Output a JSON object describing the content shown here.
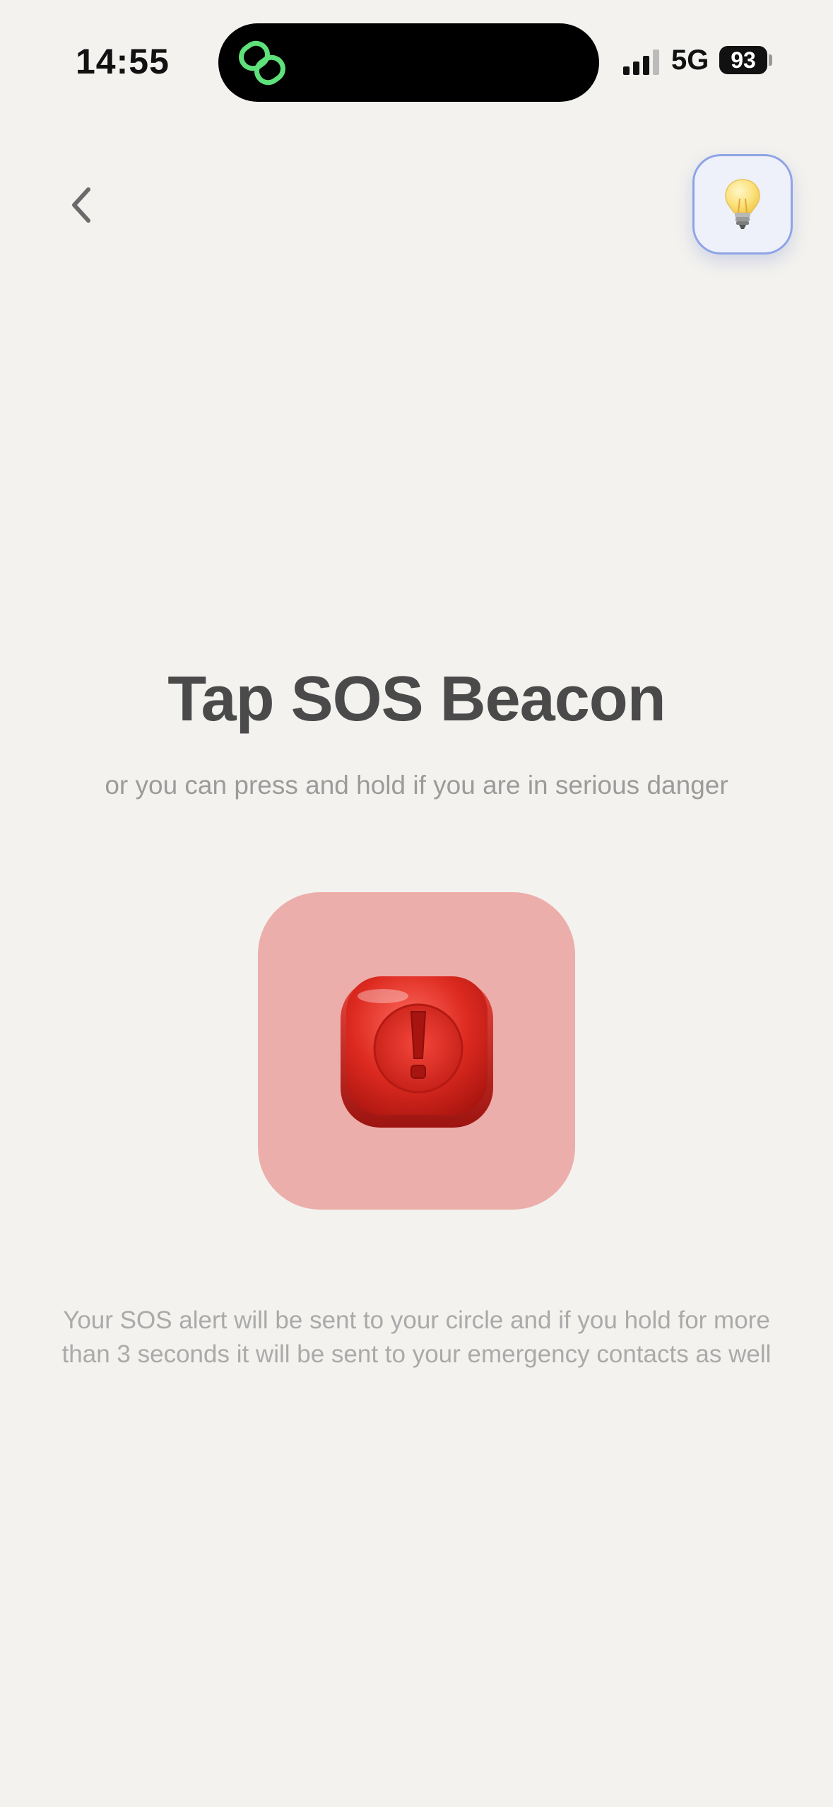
{
  "status_bar": {
    "time": "14:55",
    "network": "5G",
    "battery": "93",
    "island_icon": "link-rings-icon"
  },
  "header": {
    "back_icon": "chevron-left-icon",
    "tips_icon": "lightbulb-icon"
  },
  "main": {
    "title": "Tap SOS Beacon",
    "subtitle": "or you can press and hold if you are in serious danger",
    "sos_icon": "exclamation-button-icon",
    "footnote": "Your SOS alert will be sent to your circle and if you hold for more than 3 seconds it will be sent to your emergency contacts as well"
  },
  "colors": {
    "background": "#f3f2ef",
    "sos_card": "#ecaeab",
    "sos_button": "#d62a22",
    "tips_border": "#8fa4e6",
    "island_icon": "#5ee07a"
  }
}
